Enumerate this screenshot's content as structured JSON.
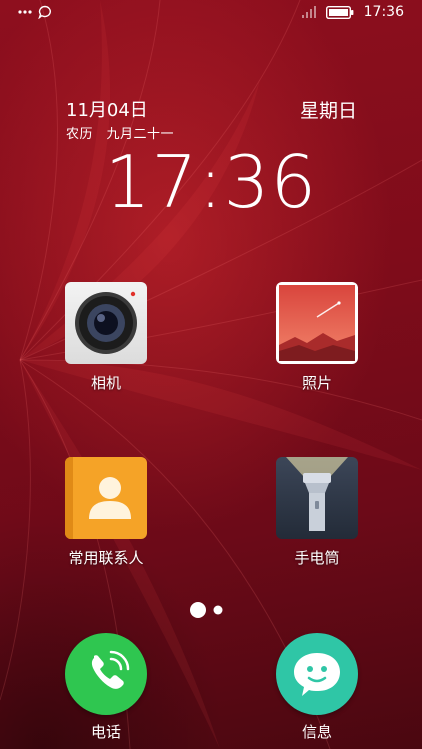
{
  "status_bar": {
    "left_icons": [
      "more-dots-icon",
      "chat-bubble-icon"
    ],
    "right_icons": [
      "signal-icon",
      "battery-icon"
    ],
    "time": "17:36"
  },
  "widget": {
    "date": "11月04日",
    "lunar": "农历　九月二十一",
    "weekday": "星期日",
    "time": "17:36"
  },
  "apps": [
    {
      "label": "相机",
      "icon": "camera-icon"
    },
    {
      "label": "照片",
      "icon": "photos-icon"
    },
    {
      "label": "常用联系人",
      "icon": "contacts-icon"
    },
    {
      "label": "手电筒",
      "icon": "flashlight-icon"
    }
  ],
  "pager": {
    "pages": 2,
    "current": 1
  },
  "dock": [
    {
      "label": "电话",
      "icon": "phone-icon",
      "color": "#2fc650"
    },
    {
      "label": "信息",
      "icon": "message-icon",
      "color": "#2fc6a6"
    }
  ],
  "colors": {
    "wallpaper": "#7f0c1a",
    "camera_dot": "#e0302a",
    "contacts_bg": "#f5a327"
  }
}
